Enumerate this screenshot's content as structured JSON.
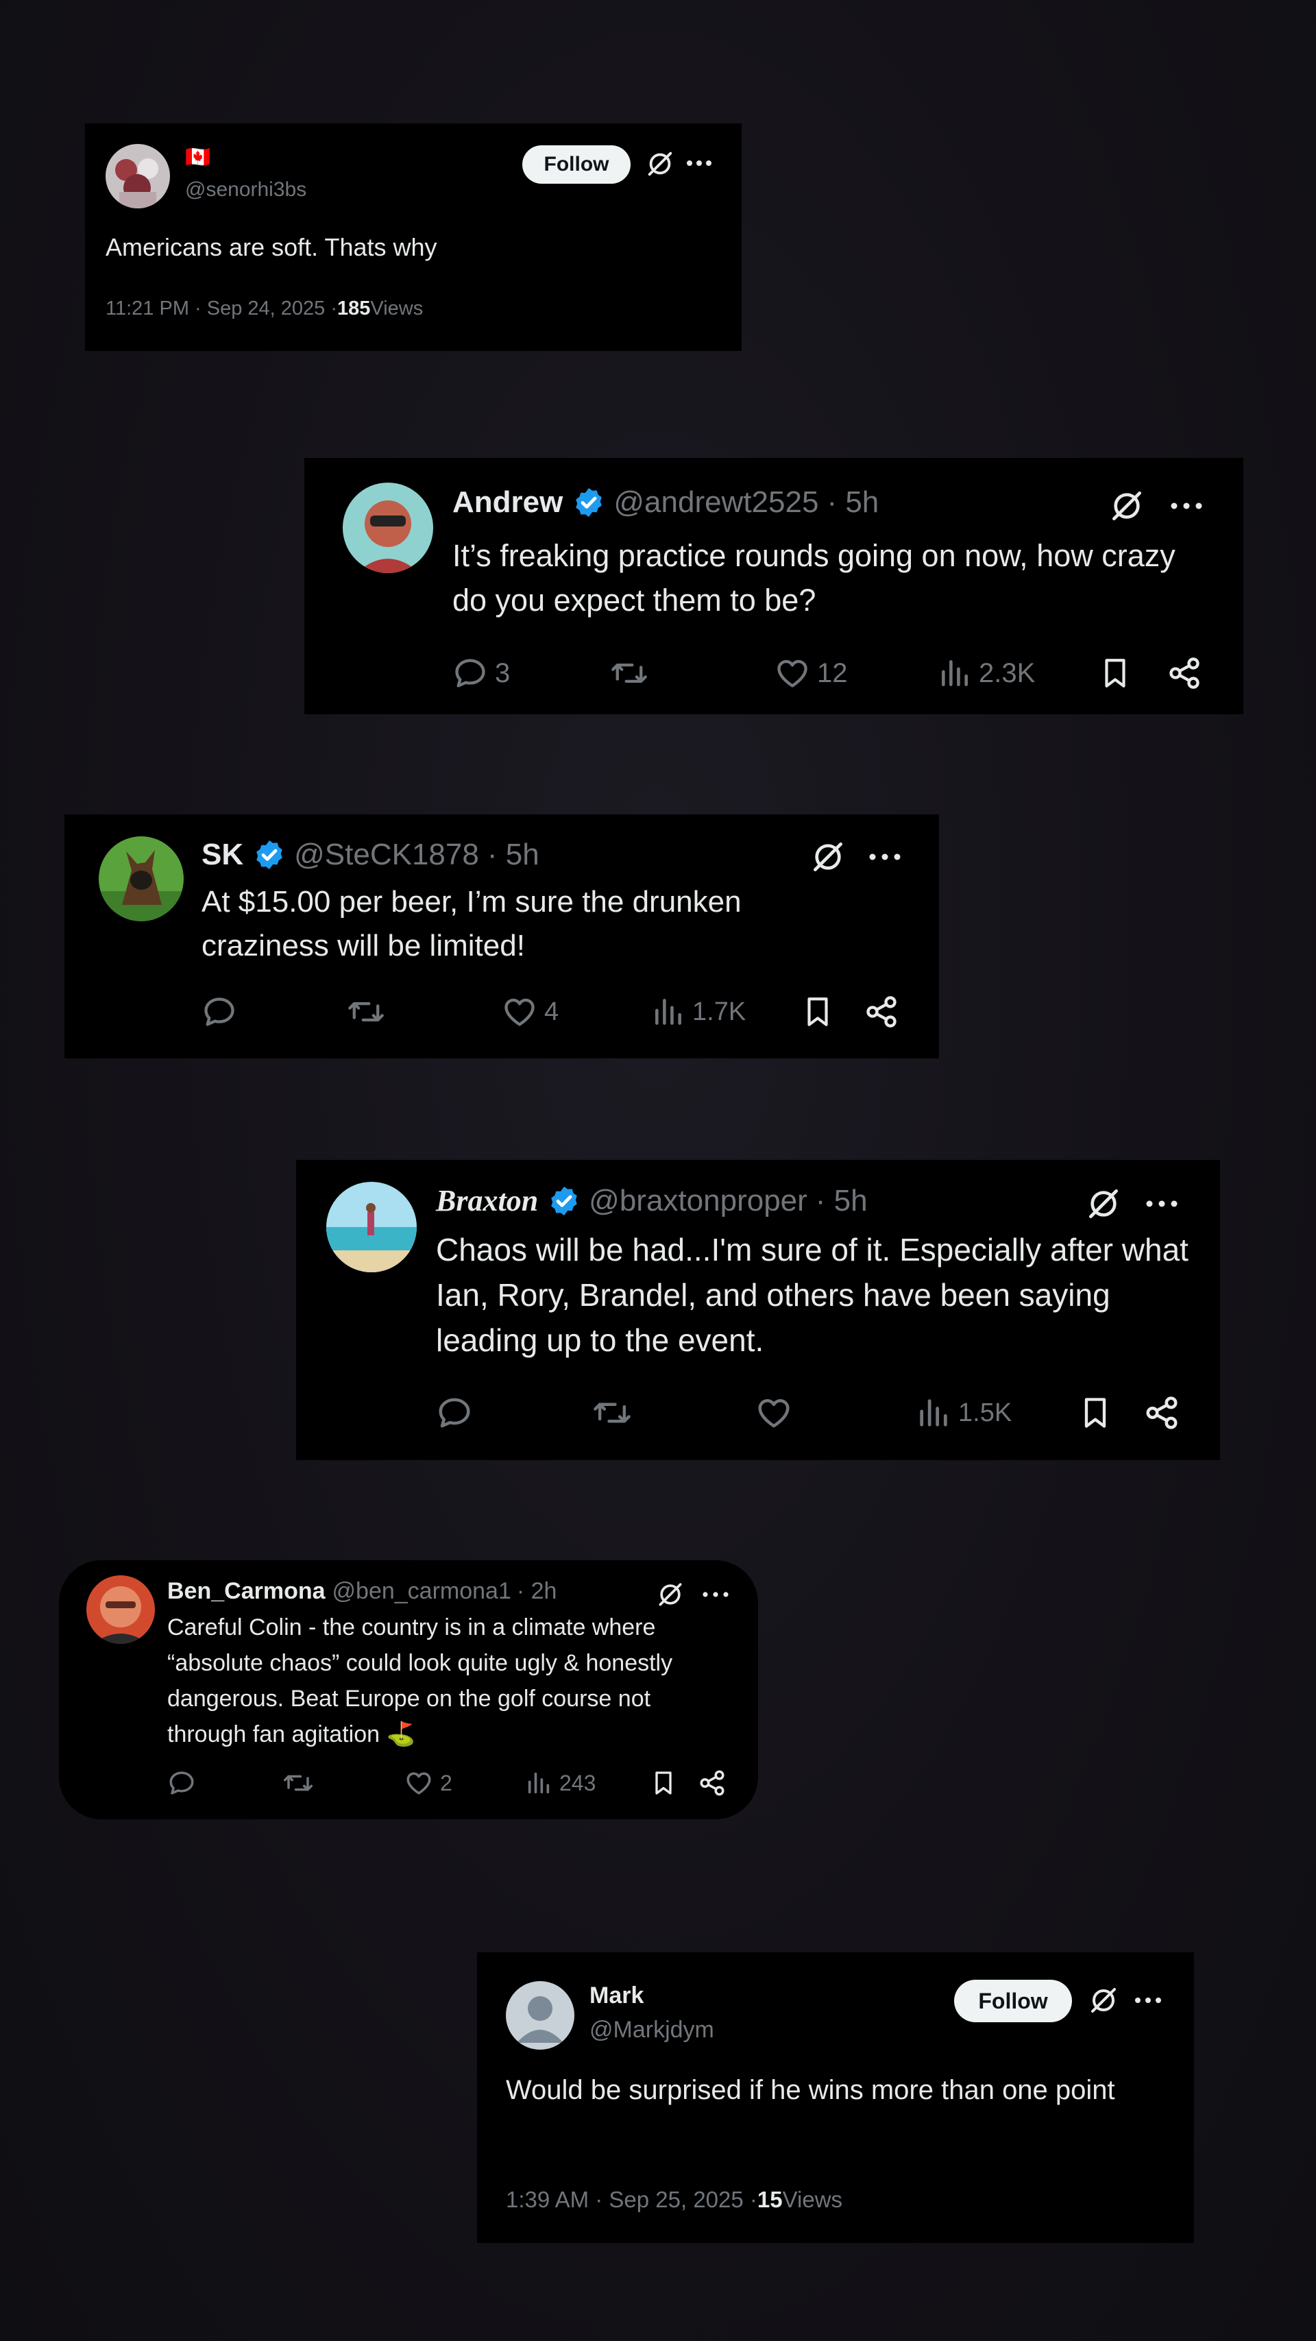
{
  "posts": [
    {
      "flag": "🇨🇦",
      "handle": "@senorhi3bs",
      "follow_label": "Follow",
      "text": "Americans are soft. Thats why",
      "timestamp": "11:21 PM · Sep 24, 2025 · ",
      "views_count": "185",
      "views_label": " Views"
    },
    {
      "name": "Andrew",
      "handle": "@andrewt2525",
      "time": "· 5h",
      "text": "It’s freaking practice rounds going on now, how crazy do you expect them to be?",
      "stats": {
        "replies": "3",
        "reposts": "",
        "likes": "12",
        "views": "2.3K"
      }
    },
    {
      "name": "SK",
      "handle": "@SteCK1878",
      "time": "· 5h",
      "text": "At $15.00 per beer, I’m sure the drunken craziness will be limited!",
      "stats": {
        "replies": "",
        "reposts": "",
        "likes": "4",
        "views": "1.7K"
      }
    },
    {
      "name": "Braxton",
      "handle": "@braxtonproper",
      "time": "· 5h",
      "text": "Chaos will be had...I'm sure of it. Especially after what Ian, Rory, Brandel, and others have been saying leading up to the event.",
      "stats": {
        "replies": "",
        "reposts": "",
        "likes": "",
        "views": "1.5K"
      }
    },
    {
      "name": "Ben_Carmona",
      "handle": "@ben_carmona1",
      "time": "· 2h",
      "text": "Careful Colin - the country is in a climate where “absolute chaos” could look quite ugly & honestly dangerous. Beat Europe on the golf course not through fan agitation ⛳",
      "stats": {
        "replies": "",
        "reposts": "",
        "likes": "2",
        "views": "243"
      }
    },
    {
      "name": "Mark",
      "handle": "@Markjdym",
      "follow_label": "Follow",
      "text": "Would be surprised if he wins more than one point",
      "timestamp": "1:39 AM · Sep 25, 2025 · ",
      "views_count": "15",
      "views_label": " Views"
    }
  ],
  "colors": {
    "verified": "#1d9bf0",
    "muted": "#71767b",
    "text": "#e7e9ea",
    "card": "#000000"
  },
  "icons": [
    "grok-icon",
    "more-icon",
    "reply-icon",
    "repost-icon",
    "like-icon",
    "views-icon",
    "bookmark-icon",
    "share-icon",
    "verified-badge-icon"
  ]
}
